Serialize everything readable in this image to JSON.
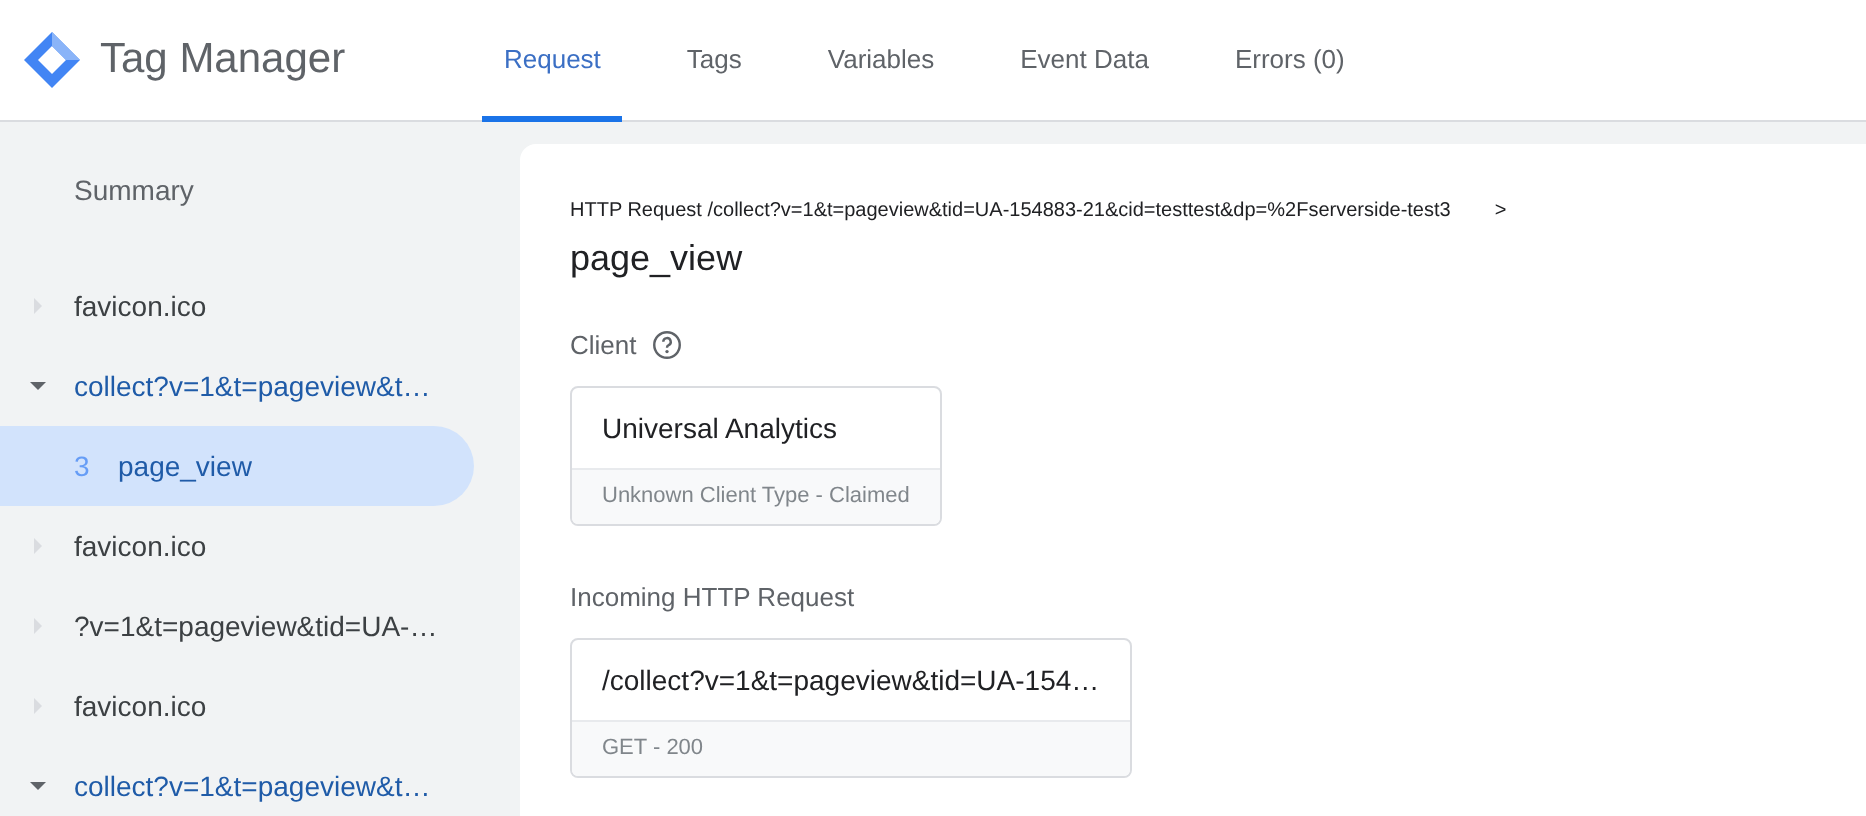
{
  "app": {
    "title": "Tag Manager"
  },
  "tabs": [
    {
      "label": "Request",
      "selected": true
    },
    {
      "label": "Tags",
      "selected": false
    },
    {
      "label": "Variables",
      "selected": false
    },
    {
      "label": "Event Data",
      "selected": false
    },
    {
      "label": "Errors (0)",
      "selected": false
    }
  ],
  "sidebar": {
    "summary": "Summary",
    "items": [
      {
        "label": "favicon.ico",
        "expanded": false,
        "selected": false
      },
      {
        "label": "collect?v=1&t=pageview&t…",
        "expanded": true,
        "selected": false,
        "children": [
          {
            "index": "3",
            "label": "page_view",
            "selected": true
          }
        ]
      },
      {
        "label": "favicon.ico",
        "expanded": false,
        "selected": false
      },
      {
        "label": "?v=1&t=pageview&tid=UA-…",
        "expanded": false,
        "selected": false
      },
      {
        "label": "favicon.ico",
        "expanded": false,
        "selected": false
      },
      {
        "label": "collect?v=1&t=pageview&t…",
        "expanded": true,
        "selected": false
      }
    ]
  },
  "detail": {
    "breadcrumb": "HTTP Request /collect?v=1&t=pageview&tid=UA-154883-21&cid=testtest&dp=%2Fserverside-test3",
    "breadcrumb_separator": ">",
    "title": "page_view",
    "sections": [
      {
        "label": "Client",
        "help": true,
        "card_title": "Universal Analytics",
        "card_footer": "Unknown Client Type - Claimed"
      },
      {
        "label": "Incoming HTTP Request",
        "help": false,
        "card_title": "/collect?v=1&t=pageview&tid=UA-154…",
        "card_footer": "GET - 200"
      }
    ]
  }
}
